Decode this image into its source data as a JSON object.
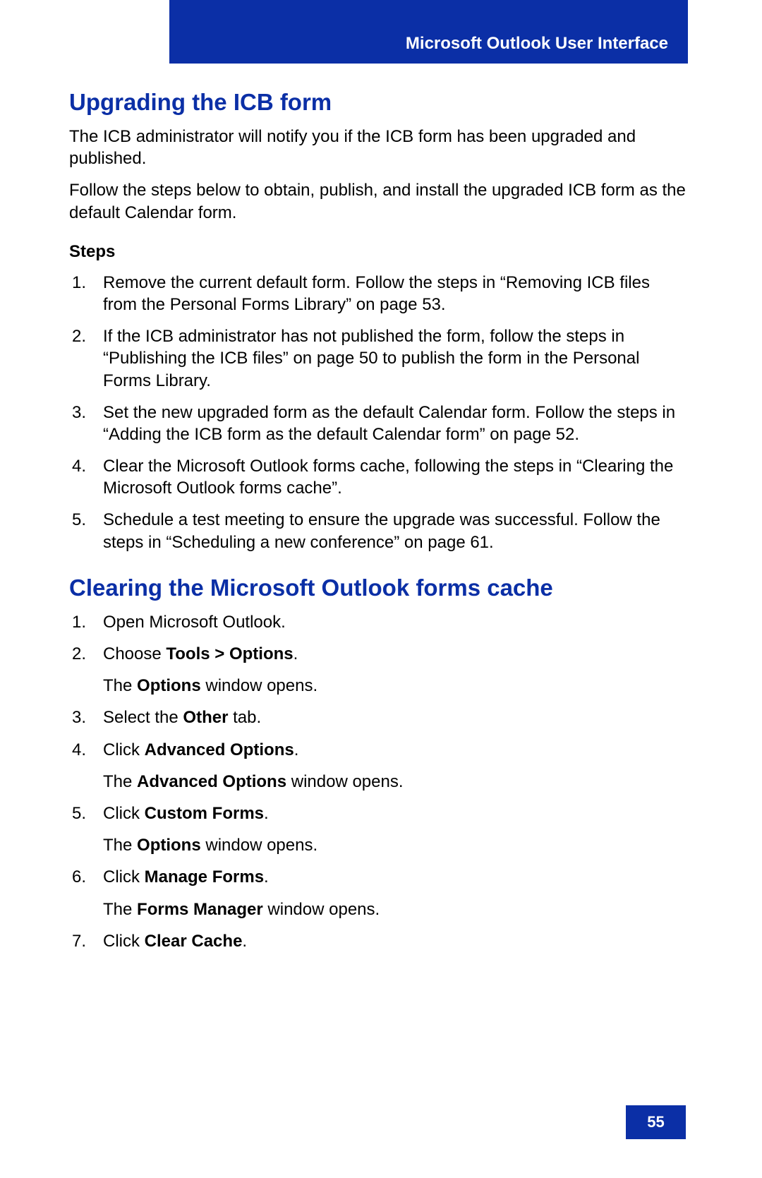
{
  "header": {
    "title": "Microsoft Outlook User Interface"
  },
  "section1": {
    "title": "Upgrading the ICB form",
    "p1": "The ICB administrator will notify you if the ICB form has been upgraded and published.",
    "p2": "Follow the steps below to obtain, publish, and install the upgraded ICB form as the default Calendar form.",
    "steps_label": "Steps",
    "steps": [
      "Remove the current default form. Follow the steps in “Removing ICB files from the Personal Forms Library” on page 53.",
      "If the ICB administrator has not published the form, follow the steps in “Publishing the ICB files” on page 50 to publish the form in the Personal Forms Library.",
      "Set the new upgraded form as the default Calendar form. Follow the steps in “Adding the ICB form as the default Calendar form” on page 52.",
      "Clear the Microsoft Outlook forms cache, following the steps in “Clearing the Microsoft Outlook forms cache”.",
      "Schedule a test meeting to ensure the upgrade was successful. Follow the steps in “Scheduling a new conference” on page 61."
    ]
  },
  "section2": {
    "title": "Clearing the Microsoft Outlook forms cache",
    "steps": [
      {
        "pre": "Open Microsoft Outlook."
      },
      {
        "pre": "Choose ",
        "bold": "Tools > Options",
        "post": ".",
        "sub_pre": "The ",
        "sub_bold": "Options",
        "sub_post": " window opens."
      },
      {
        "pre": "Select the ",
        "bold": "Other",
        "post": " tab."
      },
      {
        "pre": "Click ",
        "bold": "Advanced Options",
        "post": ".",
        "sub_pre": "The ",
        "sub_bold": "Advanced Options",
        "sub_post": " window opens."
      },
      {
        "pre": "Click ",
        "bold": "Custom Forms",
        "post": ".",
        "sub_pre": "The ",
        "sub_bold": "Options",
        "sub_post": " window opens."
      },
      {
        "pre": "Click ",
        "bold": "Manage Forms",
        "post": ".",
        "sub_pre": "The ",
        "sub_bold": "Forms Manager",
        "sub_post": " window opens."
      },
      {
        "pre": "Click ",
        "bold": "Clear Cache",
        "post": "."
      }
    ]
  },
  "page_number": "55"
}
